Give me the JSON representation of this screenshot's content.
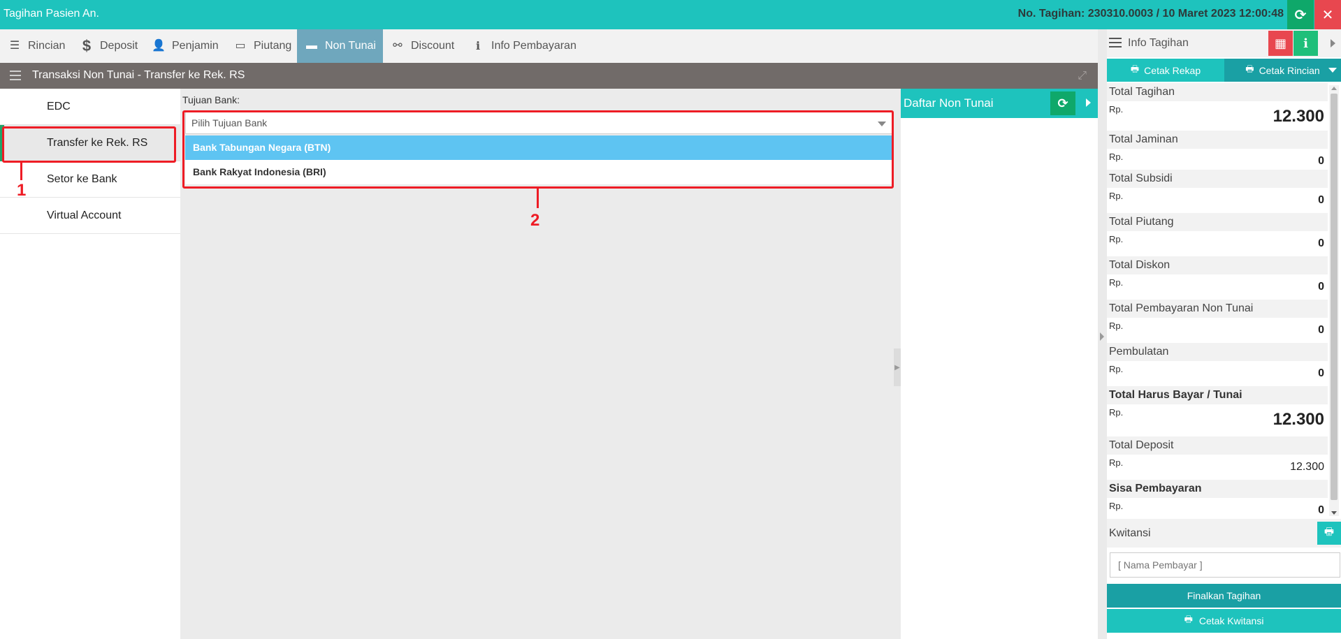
{
  "header": {
    "title": "Tagihan Pasien An.",
    "invoice_info": "No. Tagihan: 230310.0003 / 10 Maret 2023 12:00:48"
  },
  "tabs": [
    {
      "label": "Rincian",
      "icon": "list-icon"
    },
    {
      "label": "Deposit",
      "icon": "dollar-icon"
    },
    {
      "label": "Penjamin",
      "icon": "user-secret-icon"
    },
    {
      "label": "Piutang",
      "icon": "money-icon"
    },
    {
      "label": "Non Tunai",
      "icon": "credit-card-icon",
      "active": true
    },
    {
      "label": "Discount",
      "icon": "broken-link-icon"
    },
    {
      "label": "Info Pembayaran",
      "icon": "info-icon"
    }
  ],
  "subheader": {
    "title": "Transaksi Non Tunai - Transfer ke Rek. RS"
  },
  "left_nav": [
    {
      "label": "EDC"
    },
    {
      "label": "Transfer ke Rek. RS",
      "active": true
    },
    {
      "label": "Setor ke Bank"
    },
    {
      "label": "Virtual Account"
    }
  ],
  "form": {
    "bank_label": "Tujuan Bank:",
    "bank_placeholder": "Pilih Tujuan Bank",
    "options": [
      {
        "label": "Bank Tabungan Negara (BTN)",
        "highlighted": true
      },
      {
        "label": "Bank Rakyat Indonesia (BRI)"
      }
    ]
  },
  "annotations": [
    "1",
    "2"
  ],
  "daftar": {
    "title": "Daftar Non Tunai"
  },
  "info_panel": {
    "title": "Info Tagihan",
    "cetak_rekap": "Cetak Rekap",
    "cetak_rincian": "Cetak Rincian",
    "currency": "Rp.",
    "rows": [
      {
        "label": "Total Tagihan",
        "value": "12.300"
      },
      {
        "label": "Total Jaminan",
        "value": "0"
      },
      {
        "label": "Total Subsidi",
        "value": "0"
      },
      {
        "label": "Total Piutang",
        "value": "0"
      },
      {
        "label": "Total Diskon",
        "value": "0"
      },
      {
        "label": "Total Pembayaran Non Tunai",
        "value": "0"
      },
      {
        "label": "Pembulatan",
        "value": "0"
      },
      {
        "label": "Total Harus Bayar / Tunai",
        "value": "12.300"
      },
      {
        "label": "Total Deposit",
        "value": "12.300"
      },
      {
        "label": "Sisa Pembayaran",
        "value": "0"
      }
    ],
    "kwitansi_label": "Kwitansi",
    "payer_placeholder": "[ Nama Pembayar ]",
    "finalize_label": "Finalkan Tagihan",
    "print_receipt_label": "Cetak Kwitansi"
  },
  "colors": {
    "primary": "#1ec3bd",
    "dark_teal": "#1aa0a4",
    "green": "#0fa86a",
    "red": "#e8474f",
    "subheader": "#716b69",
    "tab_active": "#6fa7bd",
    "option_highlight": "#5ec4f2",
    "annotation": "#ee1c25"
  }
}
